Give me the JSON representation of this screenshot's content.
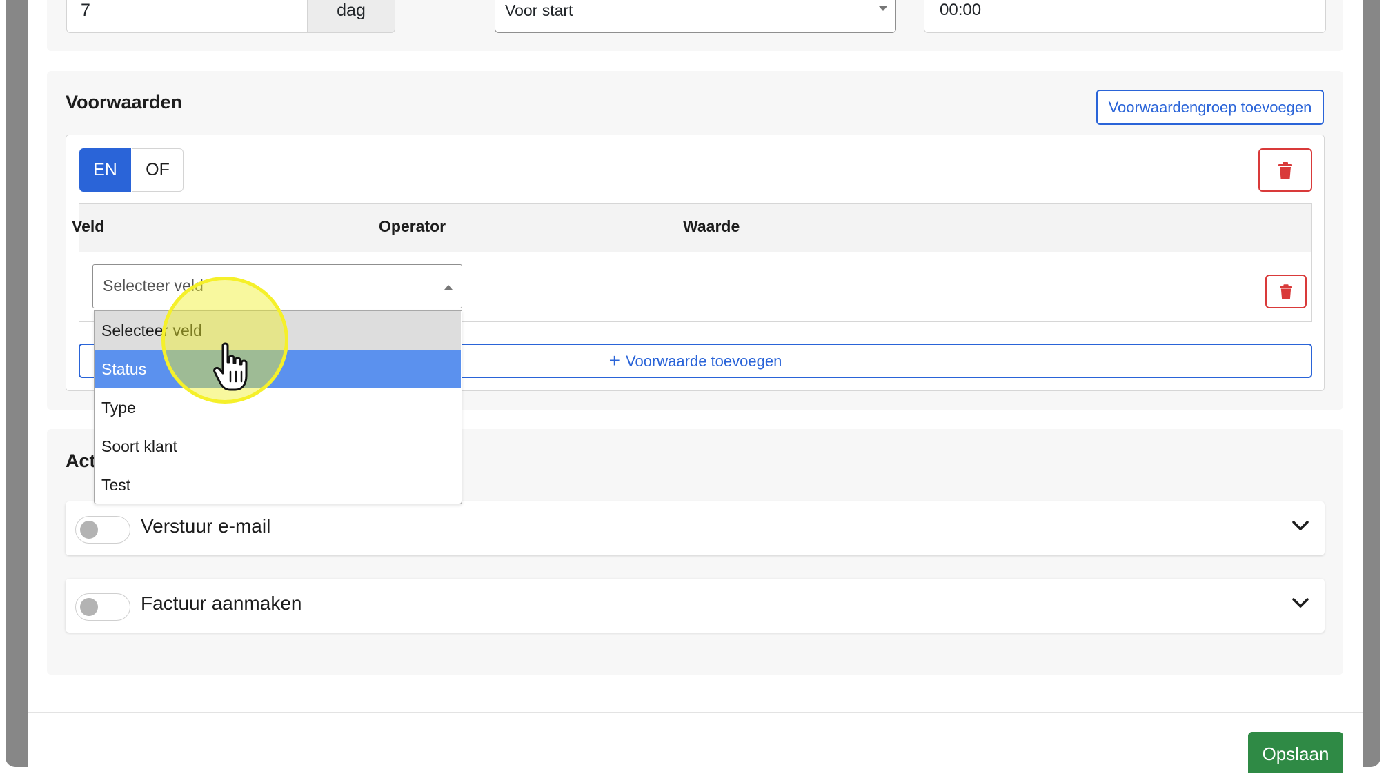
{
  "schedule": {
    "amount_value": "7",
    "amount_unit": "dag",
    "moment_selected": "Voor start",
    "time_value": "00:00"
  },
  "conditions": {
    "title": "Voorwaarden",
    "add_group_label": "Voorwaardengroep toevoegen",
    "logic_and_label": "EN",
    "logic_or_label": "OF",
    "columns": [
      "Veld",
      "Operator",
      "Waarde"
    ],
    "field_select_placeholder": "Selecteer veld",
    "add_condition_label": "Voorwaarde toevoegen",
    "field_options": [
      "Selecteer veld",
      "Status",
      "Type",
      "Soort klant",
      "Test"
    ],
    "highlighted_option": "Status"
  },
  "actions": {
    "title_visible": "Act",
    "items": [
      {
        "label": "Verstuur e-mail",
        "enabled": false
      },
      {
        "label": "Factuur aanmaken",
        "enabled": false
      }
    ]
  },
  "footer": {
    "save_label": "Opslaan"
  },
  "colors": {
    "primary": "#2a64d8",
    "danger": "#d93a3a",
    "success": "#2f8a45",
    "option_highlight": "#5b91ee"
  },
  "icons": [
    "trash-icon",
    "caret-down-icon",
    "caret-up-icon",
    "plus-icon",
    "chevron-down-icon",
    "hand-pointer-icon"
  ]
}
